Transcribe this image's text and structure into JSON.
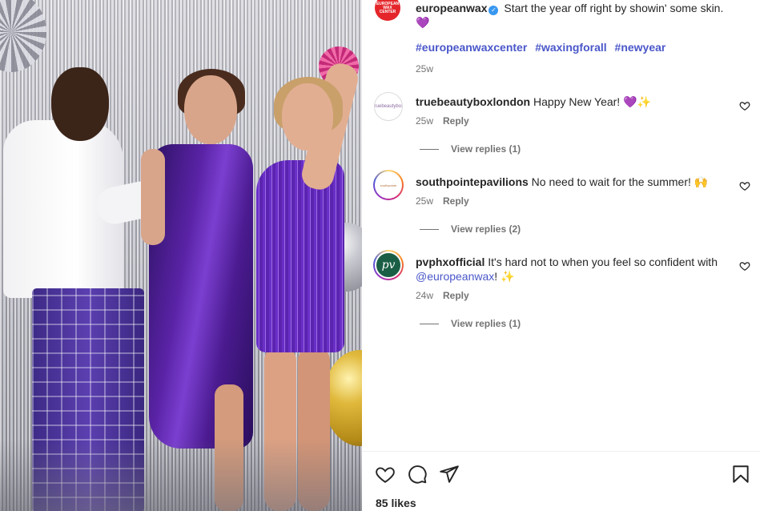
{
  "post": {
    "author": "europeanwax",
    "author_avatar_text": "EUROPEAN WAX CENTER",
    "verified_icon": "verified-badge-icon",
    "caption_text": "Start the year off right by showin' some skin.",
    "caption_emoji": "💜",
    "hashtags": [
      "#europeanwaxcenter",
      "#waxingforall",
      "#newyear"
    ],
    "time": "25w"
  },
  "comments": [
    {
      "username": "truebeautyboxlondon",
      "avatar_text": "truebeautybox",
      "text": "Happy New Year!",
      "emoji": "💜✨",
      "time": "25w",
      "reply_label": "Reply",
      "view_replies": "View replies (1)"
    },
    {
      "username": "southpointepavilions",
      "avatar_text": "southpointe",
      "text": "No need to wait for the summer!",
      "emoji": "🙌",
      "time": "25w",
      "reply_label": "Reply",
      "view_replies": "View replies (2)"
    },
    {
      "username": "pvphxofficial",
      "avatar_text": "pv",
      "text": "It's hard not to when you feel so confident with",
      "mention": "@europeanwax",
      "text_after": "!",
      "emoji": "✨",
      "time": "24w",
      "reply_label": "Reply",
      "view_replies": "View replies (1)"
    }
  ],
  "actions": {
    "icons": [
      "heart-icon",
      "comment-icon",
      "share-icon",
      "bookmark-icon"
    ],
    "likes": "85 likes"
  },
  "colors": {
    "link": "#4a57c9",
    "muted": "#737373",
    "brand_red": "#e4262b",
    "purple_heart": "#9b4fd6"
  }
}
